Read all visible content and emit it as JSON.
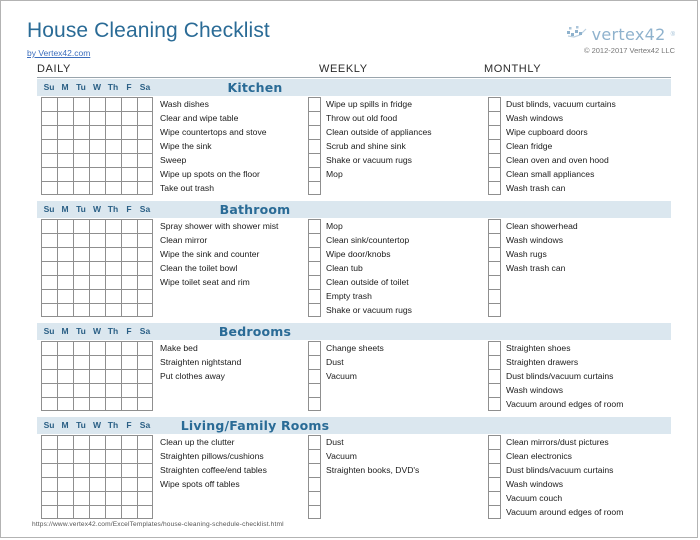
{
  "document": {
    "title": "House Cleaning Checklist",
    "byline": "by Vertex42.com",
    "footer_url": "https://www.vertex42.com/ExcelTemplates/house-cleaning-schedule-checklist.html"
  },
  "brand": {
    "name": "vertex42",
    "trademark": "®",
    "copyright": "© 2012-2017 Vertex42 LLC",
    "logo_color": "#8fb2cd"
  },
  "colors": {
    "title": "#2a6b96",
    "band": "#dbe7ef",
    "grid_line": "#8f8f8f",
    "link": "#3c6ebd"
  },
  "columns": {
    "daily": "DAILY",
    "weekly": "WEEKLY",
    "monthly": "MONTHLY"
  },
  "day_names": [
    "Su",
    "M",
    "Tu",
    "W",
    "Th",
    "F",
    "Sa"
  ],
  "sections": [
    {
      "title": "Kitchen",
      "row_count": 7,
      "daily": [
        "Wash dishes",
        "Clear and wipe table",
        "Wipe countertops and stove",
        "Wipe the sink",
        "Sweep",
        "Wipe up spots on the floor",
        "Take out trash"
      ],
      "weekly": [
        "Wipe up spills in fridge",
        "Throw out old food",
        "Clean outside of appliances",
        "Scrub and shine sink",
        "Shake or vacuum rugs",
        "Mop",
        ""
      ],
      "monthly": [
        "Dust blinds, vacuum curtains",
        "Wash windows",
        "Wipe cupboard doors",
        "Clean fridge",
        "Clean oven and oven hood",
        "Clean small appliances",
        "Wash trash can"
      ]
    },
    {
      "title": "Bathroom",
      "row_count": 7,
      "daily": [
        "Spray shower with shower mist",
        "Clean mirror",
        "Wipe the sink and counter",
        "Clean the toilet bowl",
        "Wipe toilet seat and rim",
        "",
        ""
      ],
      "weekly": [
        "Mop",
        "Clean sink/countertop",
        "Wipe door/knobs",
        "Clean tub",
        "Clean outside of toilet",
        "Empty trash",
        "Shake or vacuum rugs"
      ],
      "monthly": [
        "Clean showerhead",
        "Wash windows",
        "Wash rugs",
        "Wash trash can",
        "",
        "",
        ""
      ]
    },
    {
      "title": "Bedrooms",
      "row_count": 5,
      "daily": [
        "Make bed",
        "Straighten nightstand",
        "Put clothes away",
        "",
        ""
      ],
      "weekly": [
        "Change sheets",
        "Dust",
        "Vacuum",
        "",
        ""
      ],
      "monthly": [
        "Straighten shoes",
        "Straighten drawers",
        "Dust blinds/vacuum curtains",
        "Wash windows",
        "Vacuum around edges of room"
      ]
    },
    {
      "title": "Living/Family Rooms",
      "row_count": 6,
      "daily": [
        "Clean up the clutter",
        "Straighten pillows/cushions",
        "Straighten coffee/end tables",
        "Wipe spots off tables",
        "",
        ""
      ],
      "weekly": [
        "Dust",
        "Vacuum",
        "Straighten books, DVD's",
        "",
        "",
        ""
      ],
      "monthly": [
        "Clean mirrors/dust pictures",
        "Clean electronics",
        "Dust blinds/vacuum curtains",
        "Wash windows",
        "Vacuum couch",
        "Vacuum around edges of room"
      ]
    }
  ]
}
